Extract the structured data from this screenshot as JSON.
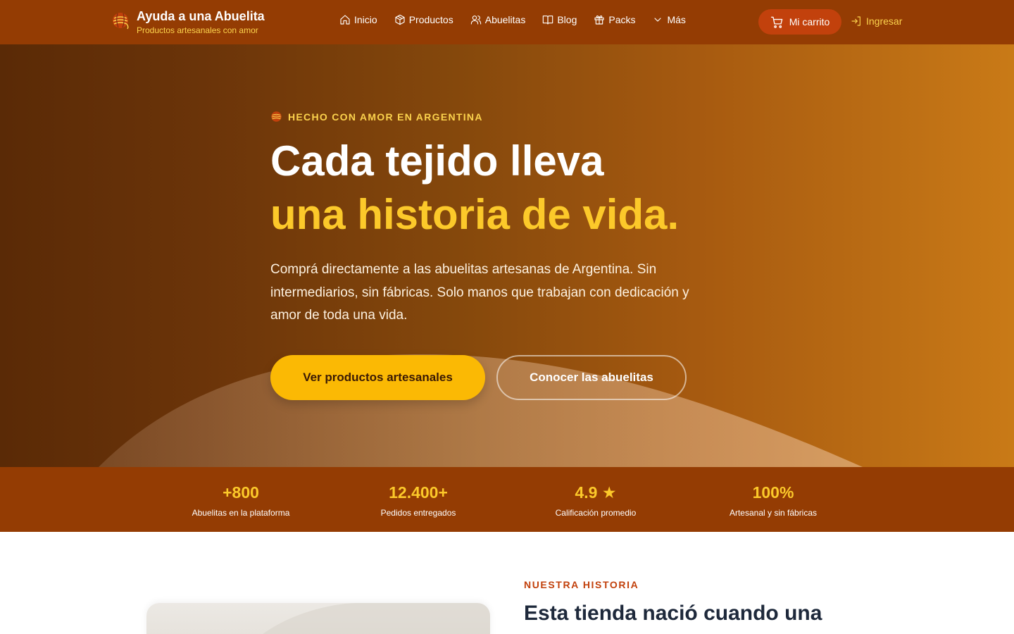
{
  "brand": {
    "title": "Ayuda a una Abuelita",
    "subtitle": "Productos artesanales con amor",
    "logo_icon": "yarn-ball-icon"
  },
  "nav": {
    "items": [
      {
        "label": "Inicio",
        "icon": "home-icon"
      },
      {
        "label": "Productos",
        "icon": "box-icon"
      },
      {
        "label": "Abuelitas",
        "icon": "users-icon"
      },
      {
        "label": "Blog",
        "icon": "book-icon"
      },
      {
        "label": "Packs",
        "icon": "gift-icon"
      },
      {
        "label": "Más",
        "icon": "chevron-down-icon"
      }
    ],
    "cart_label": "Mi carrito",
    "login_label": "Ingresar"
  },
  "hero": {
    "eyebrow": "HECHO CON AMOR EN ARGENTINA",
    "title_line1": "Cada tejido lleva",
    "title_line2": "una historia de vida.",
    "paragraph": "Comprá directamente a las abuelitas artesanas de Argentina. Sin intermediarios, sin fábricas. Solo manos que trabajan con dedicación y amor de toda una vida.",
    "cta_primary": "Ver productos artesanales",
    "cta_secondary": "Conocer las abuelitas"
  },
  "stats": [
    {
      "value": "+800",
      "label": "Abuelitas en la plataforma"
    },
    {
      "value": "12.400+",
      "label": "Pedidos entregados"
    },
    {
      "value": "4.9 ★",
      "label": "Calificación promedio"
    },
    {
      "value": "100%",
      "label": "Artesanal y sin fábricas"
    }
  ],
  "story": {
    "eyebrow": "NUESTRA HISTORIA",
    "title": "Esta tienda nació cuando una"
  },
  "colors": {
    "nav_bg": "#943c03",
    "accent_yellow": "#fbb904",
    "accent_orange": "#c2410c",
    "title_yellow": "#fcc92a"
  }
}
